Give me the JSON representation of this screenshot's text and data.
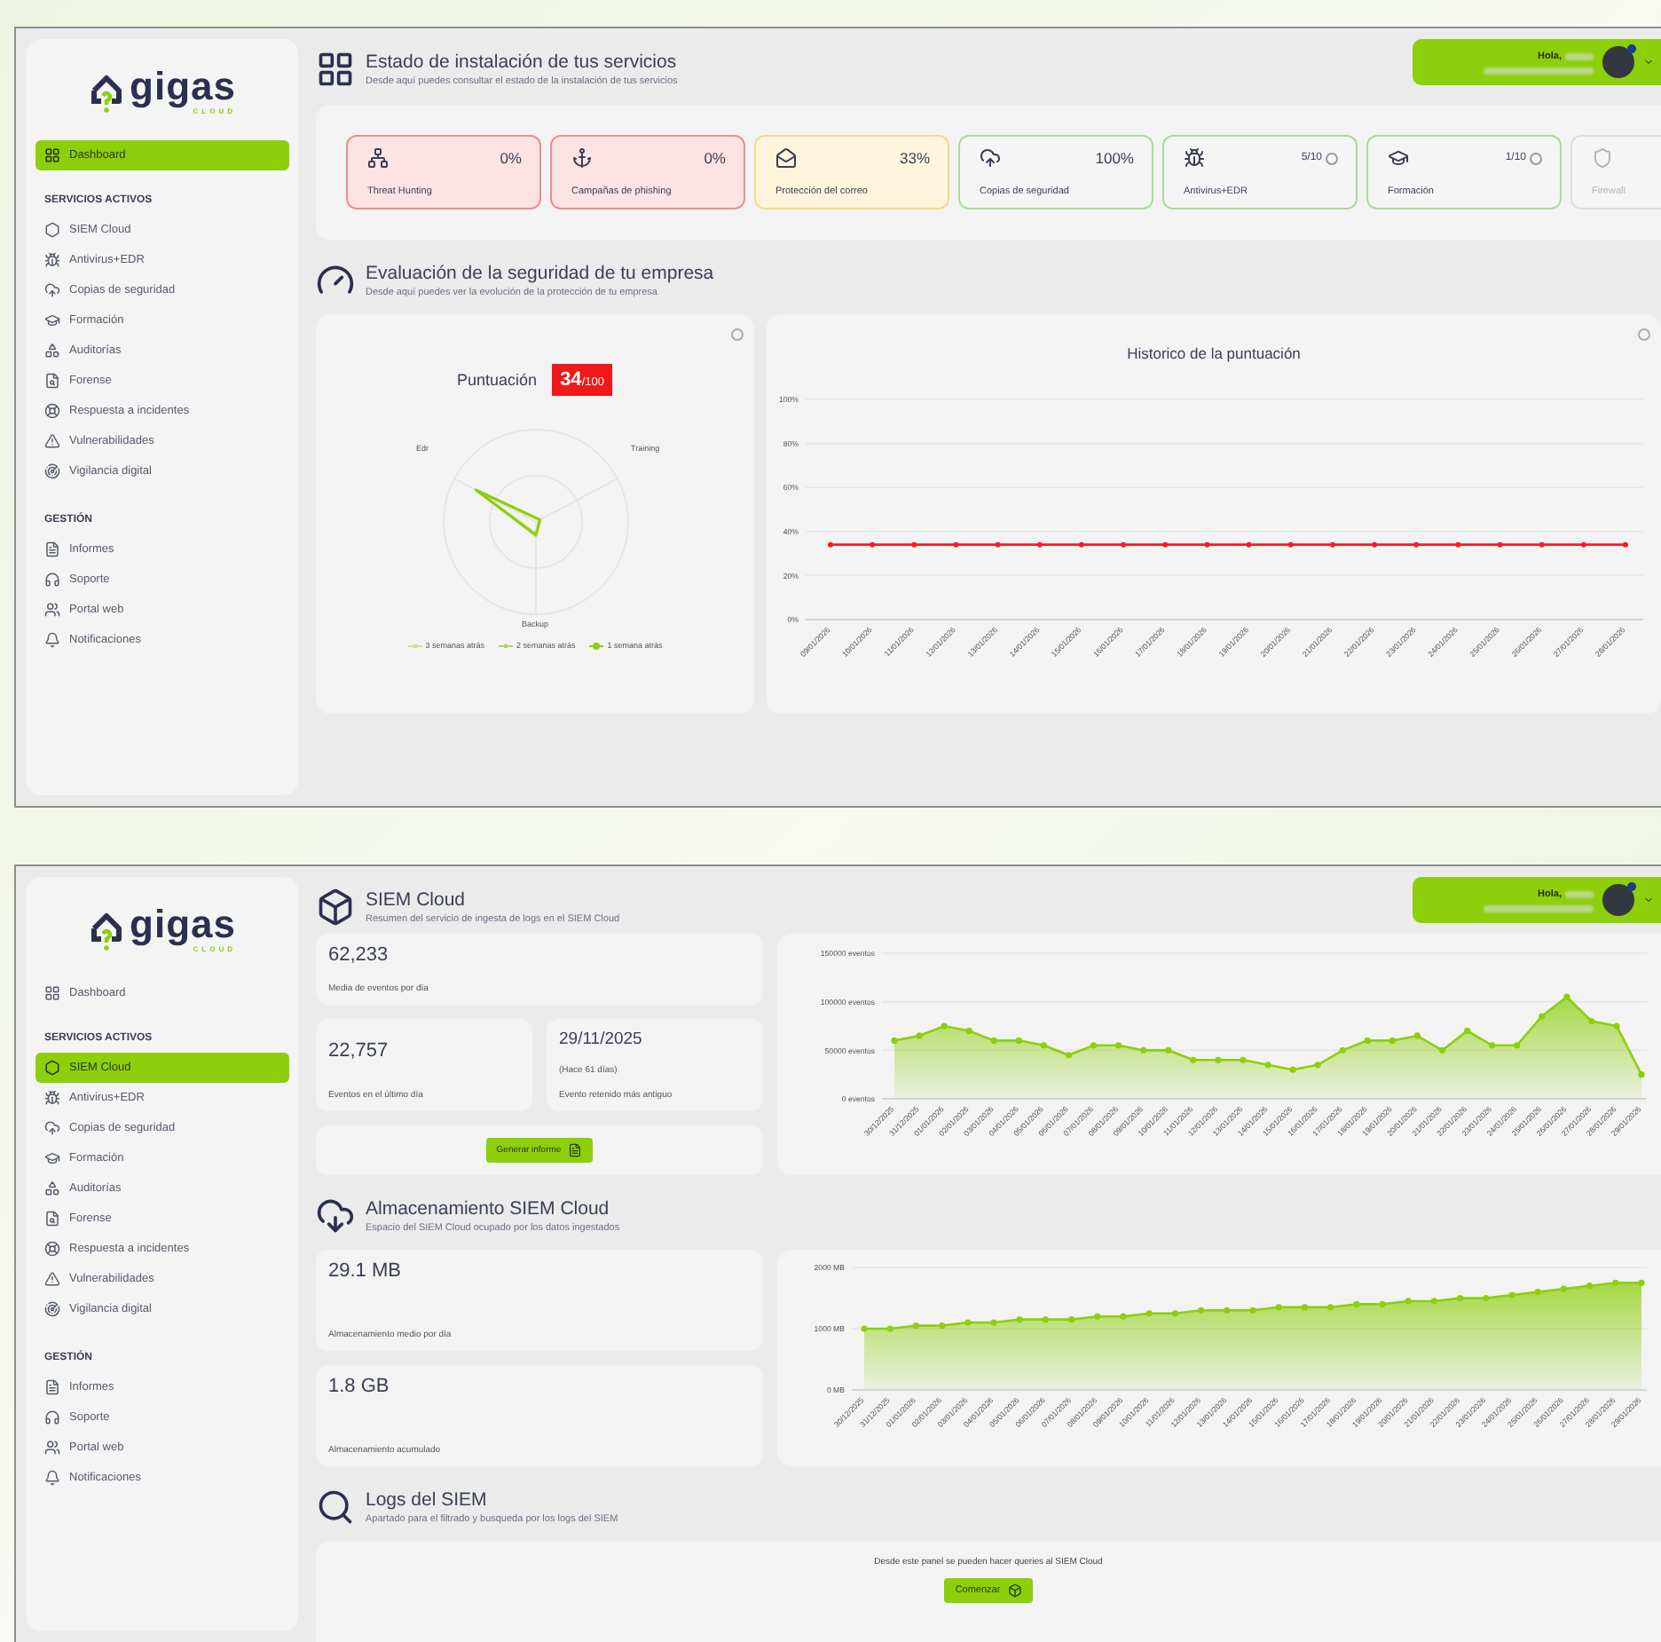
{
  "screens": [
    {
      "sidebar": {
        "logo": {
          "name": "gigas",
          "sub": "CLOUD"
        },
        "top_items": [
          {
            "label": "Dashboard",
            "selected": true
          }
        ],
        "sections": [
          {
            "title": "SERVICIOS ACTIVOS",
            "items": [
              {
                "label": "SIEM Cloud",
                "selected": false
              },
              {
                "label": "Antivirus+EDR",
                "selected": false
              },
              {
                "label": "Copias de seguridad",
                "selected": false
              },
              {
                "label": "Formación",
                "selected": false
              },
              {
                "label": "Auditorías",
                "selected": false
              },
              {
                "label": "Forense",
                "selected": false
              },
              {
                "label": "Respuesta a incidentes",
                "selected": false
              },
              {
                "label": "Vulnerabilidades",
                "selected": false
              },
              {
                "label": "Vigilancia digital",
                "selected": false
              }
            ]
          },
          {
            "title": "GESTIÓN",
            "items": [
              {
                "label": "Informes",
                "selected": false
              },
              {
                "label": "Soporte",
                "selected": false
              },
              {
                "label": "Portal web",
                "selected": false
              },
              {
                "label": "Notificaciones",
                "selected": false
              }
            ]
          }
        ]
      },
      "user": {
        "greeting": "Hola,"
      },
      "main": {
        "kind": "dashboard",
        "install": {
          "title": "Estado de instalación de tus servicios",
          "subtitle": "Desde aquí puedes consultar el estado de la instalación de tus servicios",
          "services": [
            {
              "name": "Threat Hunting",
              "value": "0%",
              "kind": "danger",
              "info": false
            },
            {
              "name": "Campañas de phishing",
              "value": "0%",
              "kind": "danger",
              "info": false
            },
            {
              "name": "Protección del correo",
              "value": "33%",
              "kind": "warning",
              "info": false
            },
            {
              "name": "Copias de seguridad",
              "value": "100%",
              "kind": "ok",
              "info": false
            },
            {
              "name": "Antivirus+EDR",
              "value": "5/10",
              "kind": "ok",
              "info": true
            },
            {
              "name": "Formación",
              "value": "1/10",
              "kind": "ok",
              "info": true
            },
            {
              "name": "Firewall",
              "kind": "inactive"
            }
          ]
        },
        "security": {
          "title": "Evaluación de la seguridad de tu empresa",
          "subtitle": "Desde aquí puedes ver la evolución de la protección de tu empresa",
          "score": {
            "label": "Puntuación",
            "value": "34",
            "max": "/100"
          },
          "radar": {
            "axes": [
              "Edr",
              "Training",
              "Backup"
            ],
            "legend": [
              {
                "label": "3 semanas atrás",
                "color": "#c9e39a"
              },
              {
                "label": "2 semanas atrás",
                "color": "#a8d65c"
              },
              {
                "label": "1 semana atrás",
                "color": "#8ccf0a"
              }
            ]
          },
          "history": {
            "chart_data": {
              "type": "line",
              "title": "Historico de la puntuación",
              "x": [
                "09/01/2026",
                "10/01/2026",
                "11/01/2026",
                "12/01/2026",
                "13/01/2026",
                "14/01/2026",
                "15/01/2026",
                "16/01/2026",
                "17/01/2026",
                "18/01/2026",
                "19/01/2026",
                "20/01/2026",
                "21/01/2026",
                "22/01/2026",
                "23/01/2026",
                "24/01/2026",
                "25/01/2026",
                "26/01/2026",
                "27/01/2026",
                "28/01/2026"
              ],
              "series": [
                {
                  "color": "#ff1a1a",
                  "values": [
                    34,
                    34,
                    34,
                    34,
                    34,
                    34,
                    34,
                    34,
                    34,
                    34,
                    34,
                    34,
                    34,
                    34,
                    34,
                    34,
                    34,
                    34,
                    34,
                    34
                  ],
                  "marker": true
                }
              ],
              "grid": true,
              "ylim": [
                0,
                100
              ],
              "yticks": [
                {
                  "value": 0,
                  "label": "0%"
                },
                {
                  "value": 20,
                  "label": "20%"
                },
                {
                  "value": 40,
                  "label": "40%"
                },
                {
                  "value": 60,
                  "label": "60%"
                },
                {
                  "value": 80,
                  "label": "80%"
                },
                {
                  "value": 100,
                  "label": "100%"
                }
              ]
            }
          }
        }
      }
    },
    {
      "sidebar": {
        "logo": {
          "name": "gigas",
          "sub": "CLOUD"
        },
        "top_items": [
          {
            "label": "Dashboard",
            "selected": false
          }
        ],
        "sections": [
          {
            "title": "SERVICIOS ACTIVOS",
            "items": [
              {
                "label": "SIEM Cloud",
                "selected": true
              },
              {
                "label": "Antivirus+EDR",
                "selected": false
              },
              {
                "label": "Copias de seguridad",
                "selected": false
              },
              {
                "label": "Formación",
                "selected": false
              },
              {
                "label": "Auditorías",
                "selected": false
              },
              {
                "label": "Forense",
                "selected": false
              },
              {
                "label": "Respuesta a incidentes",
                "selected": false
              },
              {
                "label": "Vulnerabilidades",
                "selected": false
              },
              {
                "label": "Vigilancia digital",
                "selected": false
              }
            ]
          },
          {
            "title": "GESTIÓN",
            "items": [
              {
                "label": "Informes",
                "selected": false
              },
              {
                "label": "Soporte",
                "selected": false
              },
              {
                "label": "Portal web",
                "selected": false
              },
              {
                "label": "Notificaciones",
                "selected": false
              }
            ]
          }
        ]
      },
      "user": {
        "greeting": "Hola,"
      },
      "main": {
        "kind": "siem",
        "siem": {
          "title": "SIEM Cloud",
          "subtitle": "Resumen del servicio de ingesta de logs en el SIEM Cloud",
          "average": {
            "value": "62,233",
            "label": "Media de eventos por día"
          },
          "last_day": {
            "value": "22,757",
            "label": "Eventos en el último día"
          },
          "oldest": {
            "value": "29/11/2025",
            "note": "(Hace 61 días)",
            "label": "Evento retenido más antiguo"
          },
          "report_button": "Generar informe",
          "chart_data": {
            "type": "area",
            "x": [
              "30/12/2025",
              "31/12/2025",
              "01/01/2026",
              "02/01/2026",
              "03/01/2026",
              "04/01/2026",
              "05/01/2026",
              "06/01/2026",
              "07/01/2026",
              "08/01/2026",
              "09/01/2026",
              "10/01/2026",
              "11/01/2026",
              "12/01/2026",
              "13/01/2026",
              "14/01/2026",
              "15/01/2026",
              "16/01/2026",
              "17/01/2026",
              "18/01/2026",
              "19/01/2026",
              "20/01/2026",
              "21/01/2026",
              "22/01/2026",
              "23/01/2026",
              "24/01/2026",
              "25/01/2026",
              "26/01/2026",
              "27/01/2026",
              "28/01/2026",
              "29/01/2026"
            ],
            "series": [
              {
                "color": "#8ccf0a",
                "values": [
                  60000,
                  65000,
                  75000,
                  70000,
                  60000,
                  60000,
                  55000,
                  45000,
                  55000,
                  55000,
                  50000,
                  50000,
                  40000,
                  40000,
                  40000,
                  35000,
                  30000,
                  35000,
                  50000,
                  60000,
                  60000,
                  65000,
                  50000,
                  70000,
                  55000,
                  55000,
                  85000,
                  105000,
                  80000,
                  75000,
                  25000
                ],
                "marker": true
              }
            ],
            "grid": true,
            "ylim": [
              0,
              150000
            ],
            "yticks": [
              {
                "value": 0,
                "label": "0 eventos"
              },
              {
                "value": 50000,
                "label": "50000 eventos"
              },
              {
                "value": 100000,
                "label": "100000 eventos"
              },
              {
                "value": 150000,
                "label": "150000 eventos"
              }
            ]
          }
        },
        "storage": {
          "title": "Almacenamiento SIEM Cloud",
          "subtitle": "Espacio del SIEM Cloud ocupado por los datos ingestados",
          "average": {
            "value": "29.1 MB",
            "label": "Almacenamiento medio por día"
          },
          "total": {
            "value": "1.8 GB",
            "label": "Almacenamiento acumulado"
          },
          "chart_data": {
            "type": "area",
            "x": [
              "30/12/2025",
              "31/12/2025",
              "01/01/2026",
              "02/01/2026",
              "03/01/2026",
              "04/01/2026",
              "05/01/2026",
              "06/01/2026",
              "07/01/2026",
              "08/01/2026",
              "09/01/2026",
              "10/01/2026",
              "11/01/2026",
              "12/01/2026",
              "13/01/2026",
              "14/01/2026",
              "15/01/2026",
              "16/01/2026",
              "17/01/2026",
              "18/01/2026",
              "19/01/2026",
              "20/01/2026",
              "21/01/2026",
              "22/01/2026",
              "23/01/2026",
              "24/01/2026",
              "25/01/2026",
              "26/01/2026",
              "27/01/2026",
              "28/01/2026",
              "29/01/2026"
            ],
            "series": [
              {
                "color": "#8ccf0a",
                "values": [
                  1000,
                  1000,
                  1050,
                  1050,
                  1100,
                  1100,
                  1150,
                  1150,
                  1150,
                  1200,
                  1200,
                  1250,
                  1250,
                  1300,
                  1300,
                  1300,
                  1350,
                  1350,
                  1350,
                  1400,
                  1400,
                  1450,
                  1450,
                  1500,
                  1500,
                  1550,
                  1600,
                  1650,
                  1700,
                  1750,
                  1750
                ],
                "marker": true
              }
            ],
            "grid": true,
            "ylim": [
              0,
              2000
            ],
            "yticks": [
              {
                "value": 0,
                "label": "0 MB"
              },
              {
                "value": 1000,
                "label": "1000 MB"
              },
              {
                "value": 2000,
                "label": "2000 MB"
              }
            ]
          }
        },
        "logs": {
          "title": "Logs del SIEM",
          "subtitle": "Apartado para el filtrado y busqueda por los logs del SIEM",
          "text": "Desde este panel se pueden hacer queries al SIEM Cloud",
          "button": "Comenzar"
        }
      }
    }
  ]
}
